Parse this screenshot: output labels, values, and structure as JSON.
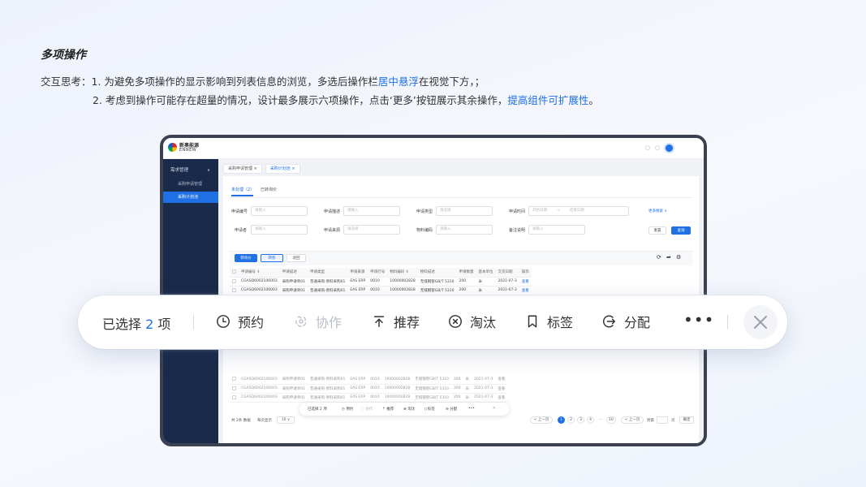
{
  "page": {
    "title": "多项操作",
    "note1_prefix": "交互思考：1. 为避免多项操作的显示影响到列表信息的浏览，多选后操作栏",
    "note1_highlight": "居中悬浮",
    "note1_suffix": "在视觉下方，；",
    "note2_prefix": "2. 考虑到操作可能存在超量的情况，设计最多展示六项操作，点击‘更多’按钮展示其余操作，",
    "note2_highlight": "提高组件可扩展性",
    "note2_suffix": "。"
  },
  "app": {
    "logo_cn": "新奥能源",
    "logo_en": "ENNEW",
    "sidebar": {
      "group": "需求管理",
      "items": [
        {
          "label": "采购申请管理"
        },
        {
          "label": "采购计划池"
        }
      ]
    },
    "tabs": [
      {
        "label": "采购申请管理 ×"
      },
      {
        "label": "采购计划池 ×"
      }
    ],
    "subtabs": [
      {
        "label": "未处理（2）"
      },
      {
        "label": "已转询价"
      }
    ],
    "filters": {
      "apply_no": {
        "label": "申请编号",
        "placeholder": "请输入"
      },
      "apply_desc": {
        "label": "申请描述",
        "placeholder": "请输入"
      },
      "apply_type": {
        "label": "申请类型",
        "placeholder": "请选择"
      },
      "apply_time": {
        "label": "申请时间",
        "start": "开始日期",
        "sep": "→",
        "end": "结束日期"
      },
      "applicant": {
        "label": "申请者",
        "placeholder": "请输入"
      },
      "apply_source": {
        "label": "申请来源",
        "placeholder": "请选择"
      },
      "material_code": {
        "label": "物料编码",
        "placeholder": "请输入"
      },
      "remark": {
        "label": "备注说明",
        "placeholder": "请输入"
      },
      "more": "更多搜索 ∨",
      "reset": "重置",
      "query": "查询"
    },
    "toolbar": {
      "to_inquiry": "转询价",
      "transfer": "转移",
      "return": "退回"
    },
    "table": {
      "headers": [
        "申请编号 ⇕",
        "申请描述",
        "申请类型",
        "申请来源",
        "申请行号",
        "物料编码 ⇕",
        "物料描述",
        "申请数量",
        "基本单位",
        "交货日期",
        "操作"
      ],
      "rows_top": [
        [
          "CGASQ6002106003",
          "采购申请单01",
          "普通采购-原料采购01",
          "EAS ERP",
          "0010",
          "10000002828",
          "无缝钢管GB/T 5310",
          "200",
          "米",
          "2021-07-3",
          "查看"
        ],
        [
          "CGASQ6002106003",
          "采购申请单01",
          "普通采购-原料采购01",
          "EAS ERP",
          "0010",
          "10000002828",
          "无缝钢管GB/T 5310",
          "200",
          "米",
          "2021-07-3",
          "查看"
        ]
      ],
      "rows_bottom": [
        [
          "CGASQ6002106003",
          "采购申请单01",
          "普通采购-原料采购01",
          "EAS ERP",
          "0010",
          "10000002828",
          "无缝钢管GB/T 5310",
          "200",
          "米",
          "2021-07-3",
          "查看"
        ],
        [
          "CGASQ6002106003",
          "采购申请单01",
          "普通采购-原料采购01",
          "EAS ERP",
          "0010",
          "10000002828",
          "无缝钢管GB/T 5310",
          "200",
          "米",
          "2021-07-3",
          "查看"
        ],
        [
          "CGASQ6002106003",
          "采购申请单01",
          "普通采购-原料采购01",
          "EAS ERP",
          "0010",
          "10000002828",
          "无缝钢管GB/T 5310",
          "200",
          "米",
          "2021-07-3",
          "查看"
        ]
      ]
    },
    "pagination": {
      "total": "共 2条 数据",
      "per_page_label": "每页显示",
      "per_page_value": "10 ∨",
      "prev": "< 上一页",
      "pages": [
        "1",
        "2",
        "3",
        "4",
        "…",
        "10"
      ],
      "next": "< 上一页",
      "goto": "到第",
      "goto_unit": "页",
      "confirm": "确定"
    },
    "mini_bar": {
      "count": "已选择 2 项",
      "items": [
        "预约",
        "协作",
        "推荐",
        "淘汰",
        "标签",
        "分配"
      ],
      "more": "•••",
      "close": "✕"
    }
  },
  "float_bar": {
    "count_prefix": "已选择",
    "count": "2",
    "count_suffix": "项",
    "actions": [
      {
        "label": "预约",
        "icon": "clock-icon",
        "enabled": true
      },
      {
        "label": "协作",
        "icon": "collaborate-icon",
        "enabled": false
      },
      {
        "label": "推荐",
        "icon": "recommend-up-icon",
        "enabled": true
      },
      {
        "label": "淘汰",
        "icon": "eliminate-icon",
        "enabled": true
      },
      {
        "label": "标签",
        "icon": "bookmark-icon",
        "enabled": true
      },
      {
        "label": "分配",
        "icon": "assign-icon",
        "enabled": true
      }
    ],
    "more": "•••",
    "close_icon": "close-icon"
  },
  "colors": {
    "accent": "#1f6fe5",
    "sidebar": "#1a2a4a",
    "disabled": "#b9bec9"
  }
}
